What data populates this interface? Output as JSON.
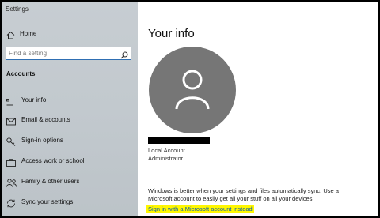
{
  "window": {
    "title": "Settings"
  },
  "sidebar": {
    "home_label": "Home",
    "search_placeholder": "Find a setting",
    "section_header": "Accounts",
    "items": [
      {
        "label": "Your info",
        "icon": "your-info-icon"
      },
      {
        "label": "Email & accounts",
        "icon": "email-icon"
      },
      {
        "label": "Sign-in options",
        "icon": "key-icon"
      },
      {
        "label": "Access work or school",
        "icon": "briefcase-icon"
      },
      {
        "label": "Family & other users",
        "icon": "people-icon"
      },
      {
        "label": "Sync your settings",
        "icon": "sync-icon"
      }
    ]
  },
  "main": {
    "title": "Your info",
    "account_type": "Local Account",
    "account_role": "Administrator",
    "sync_text": "Windows is better when your settings and files automatically sync. Use a Microsoft account to easily get all your stuff on all your devices.",
    "signin_link": "Sign in with a Microsoft account instead"
  },
  "colors": {
    "sidebar_bg": "#c2c9ce",
    "avatar_bg": "#767676",
    "link": "#0b5cad",
    "highlight": "#fff700",
    "search_border": "#2f6fb3"
  }
}
